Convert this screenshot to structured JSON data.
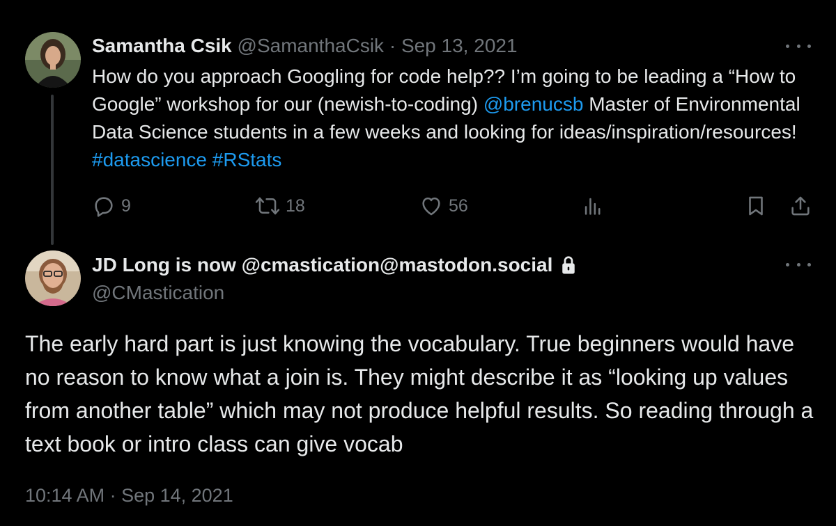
{
  "tweet1": {
    "author": {
      "name": "Samantha Csik",
      "handle": "@SamanthaCsik",
      "separator": "·",
      "date": "Sep 13, 2021",
      "avatar_icon": "profile-photo-woman"
    },
    "text": {
      "part1": "How do you approach Googling for code help?? I’m going to be leading a “How to Google” workshop for our (newish-to-coding) ",
      "mention": "@brenucsb",
      "part2": " Master of Environmental Data Science students in a few weeks and looking for ideas/inspiration/resources! ",
      "hashtag1": "#datascience",
      "space": " ",
      "hashtag2": "#RStats"
    },
    "actions": {
      "replies": "9",
      "retweets": "18",
      "likes": "56"
    }
  },
  "tweet2": {
    "author": {
      "name": "JD Long is now @cmastication@mastodon.social",
      "handle": "@CMastication",
      "protected_icon": "lock-icon",
      "avatar_icon": "profile-photo-man"
    },
    "text": "The early hard part is just knowing the vocabulary. True beginners would have no reason to know what a join is. They might describe it as “looking up values from another table” which may not produce helpful results. So reading through a text book or intro class can give vocab",
    "timestamp": "10:14 AM · Sep 14, 2021"
  },
  "colors": {
    "background": "#000000",
    "text": "#e7e9ea",
    "muted": "#71767b",
    "link": "#1d9bf0"
  }
}
